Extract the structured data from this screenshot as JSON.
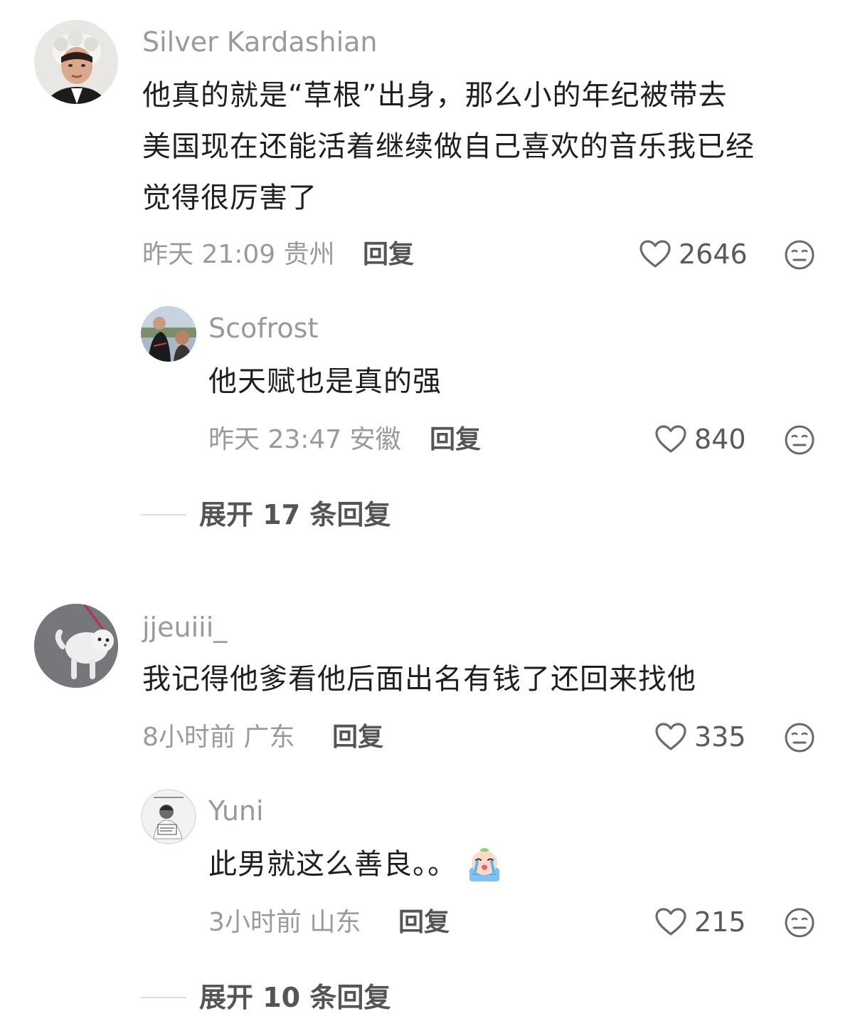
{
  "comments": [
    {
      "user": "Silver Kardashian",
      "lines": [
        "他真的就是“草根”出身，那么小的年纪被带去",
        "美国现在还能活着继续做自己喜欢的音乐我已经",
        "觉得很厉害了"
      ],
      "time": "昨天 21:09 贵州",
      "reply_label": "回复",
      "likes": "2646",
      "replies": [
        {
          "user": "Scofrost",
          "text": "他天赋也是真的强",
          "time": "昨天 23:47 安徽",
          "reply_label": "回复",
          "likes": "840"
        }
      ],
      "expand_label": "展开 17 条回复"
    },
    {
      "user": "jjeuiii_",
      "lines": [
        "我记得他爹看他后面出名有钱了还回来找他"
      ],
      "time": "8小时前 广东",
      "reply_label": "回复",
      "likes": "335",
      "replies": [
        {
          "user": "Yuni",
          "text": "此男就这么善良。。",
          "emoji": "crying-emoji",
          "time": "3小时前 山东",
          "reply_label": "回复",
          "likes": "215"
        }
      ],
      "expand_label": "展开 10 条回复"
    }
  ],
  "icons": {
    "like": "heart-outline-icon",
    "dislike": "neutral-face-icon"
  },
  "colors": {
    "username": "#9a9a9a",
    "meta": "#9a9a9a",
    "text": "#1f1f1f",
    "action": "#555555"
  }
}
